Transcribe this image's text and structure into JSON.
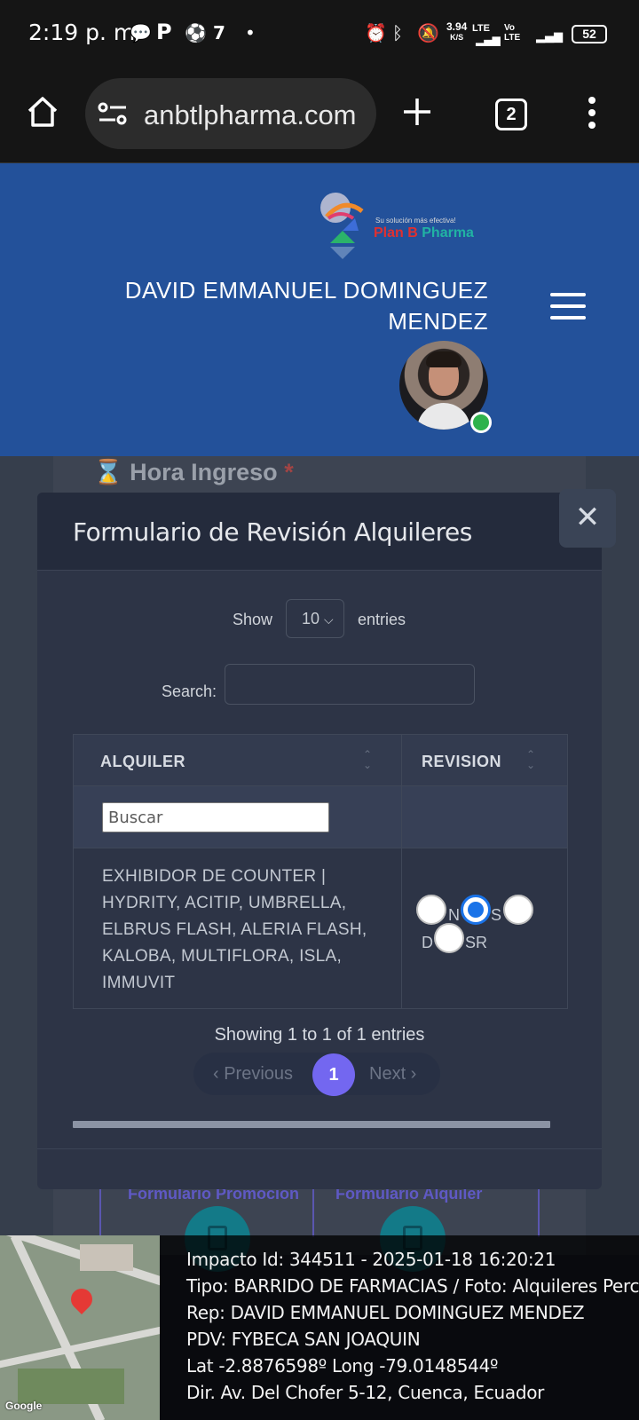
{
  "status_bar": {
    "time": "2:19 p. m.",
    "speed_value": "3.94",
    "speed_unit": "K/S",
    "network": "LTE",
    "network2": "Vo LTE",
    "battery": "52"
  },
  "browser": {
    "url": "anbtlpharma.com",
    "tab_count": "2"
  },
  "header": {
    "logo_tagline": "Su solución más efectiva!",
    "logo_name_red": "Plan B",
    "logo_name_green": "Pharma",
    "user_name": "DAVID EMMANUEL DOMINGUEZ MENDEZ"
  },
  "background_form": {
    "field_label": "Hora Ingreso",
    "required_mark": "*",
    "card_promocion": "Formulario Promocion",
    "card_alquiler": "Formulario Alquiler"
  },
  "modal": {
    "title": "Formulario de Revisión Alquileres",
    "close_symbol": "✕",
    "show_label": "Show",
    "page_size": "10",
    "entries_label": "entries",
    "search_label": "Search:",
    "search_value": "",
    "columns": [
      "ALQUILER",
      "REVISION"
    ],
    "filter_placeholder": "Buscar",
    "rows": [
      {
        "alquiler": "EXHIBIDOR DE COUNTER | HYDRITY, ACITIP, UMBRELLA, ELBRUS FLASH, ALERIA FLASH, KALOBA, MULTIFLORA, ISLA, IMMUVIT",
        "revision_options": [
          "N",
          "S",
          "D",
          "SR"
        ],
        "revision_selected": "S"
      }
    ],
    "info": "Showing 1 to 1 of 1 entries",
    "pagination": {
      "previous": "‹ Previous",
      "current": "1",
      "next": "Next ›"
    }
  },
  "photo_meta": {
    "map_label": "Google",
    "lines": [
      "Impacto Id: 344511 - 2025-01-18 16:20:21",
      "Tipo: BARRIDO DE FARMACIAS / Foto: Alquileres Percha",
      "Rep: DAVID EMMANUEL DOMINGUEZ MENDEZ",
      "PDV: FYBECA SAN JOAQUIN",
      "Lat -2.8876598º Long -79.0148544º",
      "Dir. Av. Del Chofer 5-12, Cuenca, Ecuador"
    ]
  },
  "colors": {
    "header_bg": "#23519a",
    "accent": "#7367f0",
    "radio_checked": "#1a73e8",
    "online": "#2eb24c"
  }
}
